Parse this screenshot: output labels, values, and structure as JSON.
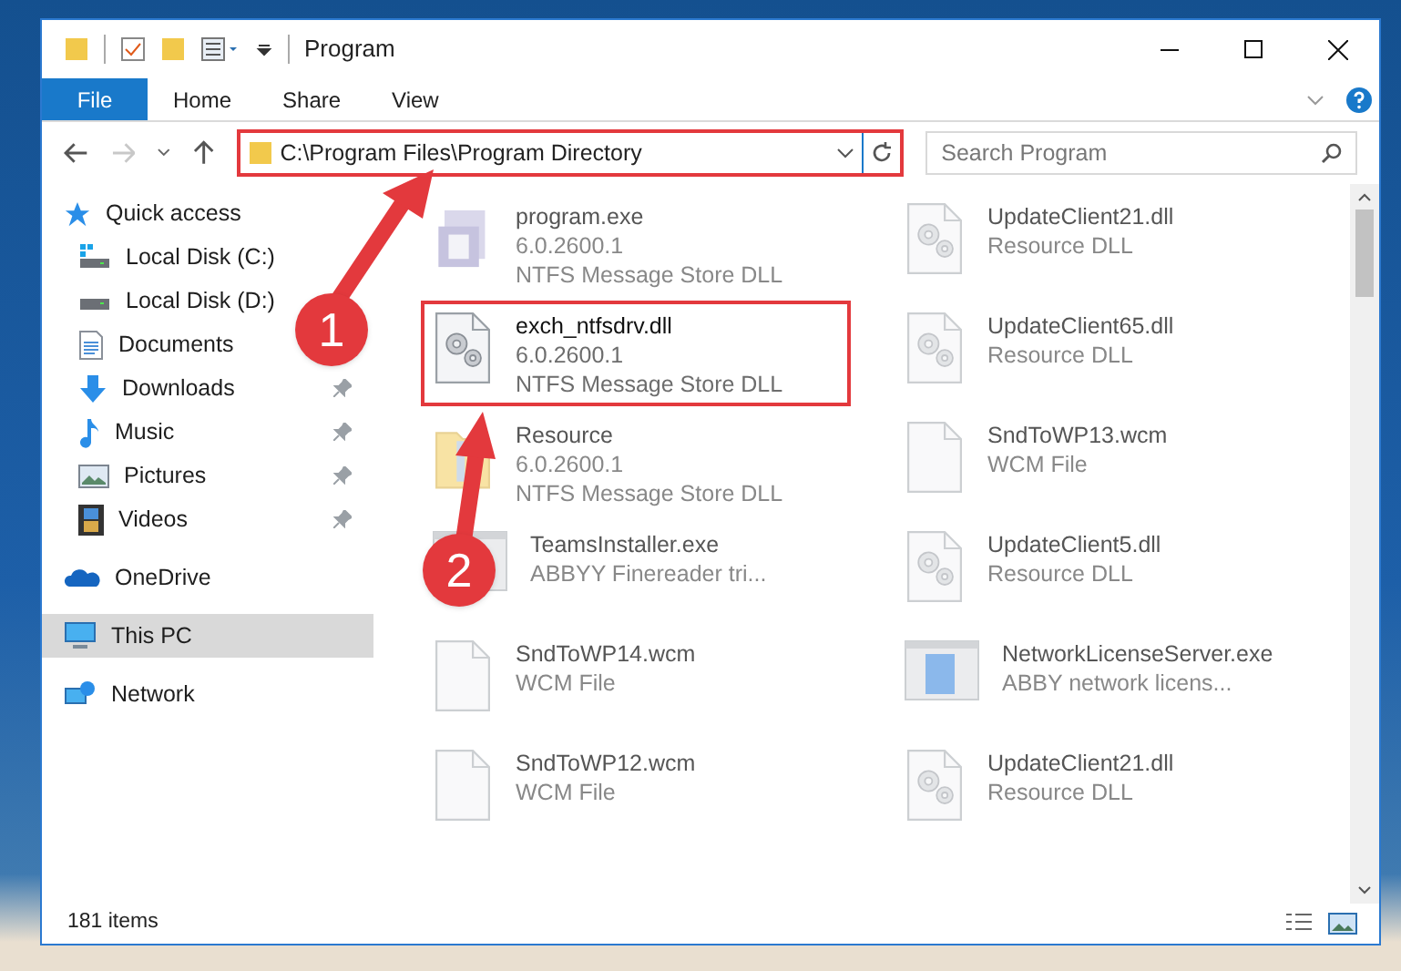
{
  "window": {
    "title": "Program"
  },
  "ribbon_tabs": [
    {
      "label": "File",
      "selected": true
    },
    {
      "label": "Home",
      "selected": false
    },
    {
      "label": "Share",
      "selected": false
    },
    {
      "label": "View",
      "selected": false
    }
  ],
  "address_bar": {
    "path": "C:\\Program Files\\Program Directory",
    "highlighted": true
  },
  "search": {
    "placeholder": "Search Program"
  },
  "sidebar": {
    "items": [
      {
        "label": "Quick access",
        "kind": "star",
        "selected": false,
        "children": [
          {
            "label": "Local Disk (C:)",
            "kind": "drive-c",
            "pinned": false,
            "selected": false
          },
          {
            "label": "Local Disk (D:)",
            "kind": "drive",
            "pinned": false,
            "selected": false
          },
          {
            "label": "Documents",
            "kind": "documents",
            "pinned": false,
            "selected": false
          },
          {
            "label": "Downloads",
            "kind": "downloads",
            "pinned": true,
            "selected": false
          },
          {
            "label": "Music",
            "kind": "music",
            "pinned": true,
            "selected": false
          },
          {
            "label": "Pictures",
            "kind": "pictures",
            "pinned": true,
            "selected": false
          },
          {
            "label": "Videos",
            "kind": "videos",
            "pinned": true,
            "selected": false
          }
        ]
      },
      {
        "label": "OneDrive",
        "kind": "cloud",
        "selected": false
      },
      {
        "label": "This PC",
        "kind": "pc",
        "selected": true
      },
      {
        "label": "Network",
        "kind": "network",
        "selected": false
      }
    ]
  },
  "files": [
    {
      "name": "program.exe",
      "lines": [
        "6.0.2600.1",
        "NTFS Message Store DLL"
      ],
      "kind": "app",
      "dimmed": true,
      "highlighted": false
    },
    {
      "name": "UpdateClient21.dll",
      "lines": [
        "Resource DLL"
      ],
      "kind": "dll",
      "dimmed": true,
      "highlighted": false
    },
    {
      "name": "exch_ntfsdrv.dll",
      "lines": [
        "6.0.2600.1",
        "NTFS Message Store DLL"
      ],
      "kind": "dll",
      "dimmed": false,
      "highlighted": true
    },
    {
      "name": "UpdateClient65.dll",
      "lines": [
        "Resource DLL"
      ],
      "kind": "dll",
      "dimmed": true,
      "highlighted": false
    },
    {
      "name": "Resource",
      "lines": [
        "6.0.2600.1",
        "NTFS Message Store DLL"
      ],
      "kind": "folder",
      "dimmed": true,
      "highlighted": false
    },
    {
      "name": "SndToWP13.wcm",
      "lines": [
        "WCM File"
      ],
      "kind": "file",
      "dimmed": true,
      "highlighted": false
    },
    {
      "name": "TeamsInstaller.exe",
      "lines": [
        "ABBYY Finereader tri..."
      ],
      "kind": "window",
      "dimmed": true,
      "highlighted": false
    },
    {
      "name": "UpdateClient5.dll",
      "lines": [
        "Resource DLL"
      ],
      "kind": "dll",
      "dimmed": true,
      "highlighted": false
    },
    {
      "name": "SndToWP14.wcm",
      "lines": [
        "WCM File"
      ],
      "kind": "file",
      "dimmed": true,
      "highlighted": false
    },
    {
      "name": "NetworkLicenseServer.exe",
      "lines": [
        "ABBY network licens..."
      ],
      "kind": "window",
      "dimmed": true,
      "highlighted": false
    },
    {
      "name": "SndToWP12.wcm",
      "lines": [
        "WCM File"
      ],
      "kind": "file",
      "dimmed": true,
      "highlighted": false
    },
    {
      "name": "UpdateClient21.dll",
      "lines": [
        "Resource DLL"
      ],
      "kind": "dll",
      "dimmed": true,
      "highlighted": false
    }
  ],
  "status_bar": {
    "item_count": "181 items"
  },
  "callouts": [
    {
      "number": "1"
    },
    {
      "number": "2"
    }
  ]
}
